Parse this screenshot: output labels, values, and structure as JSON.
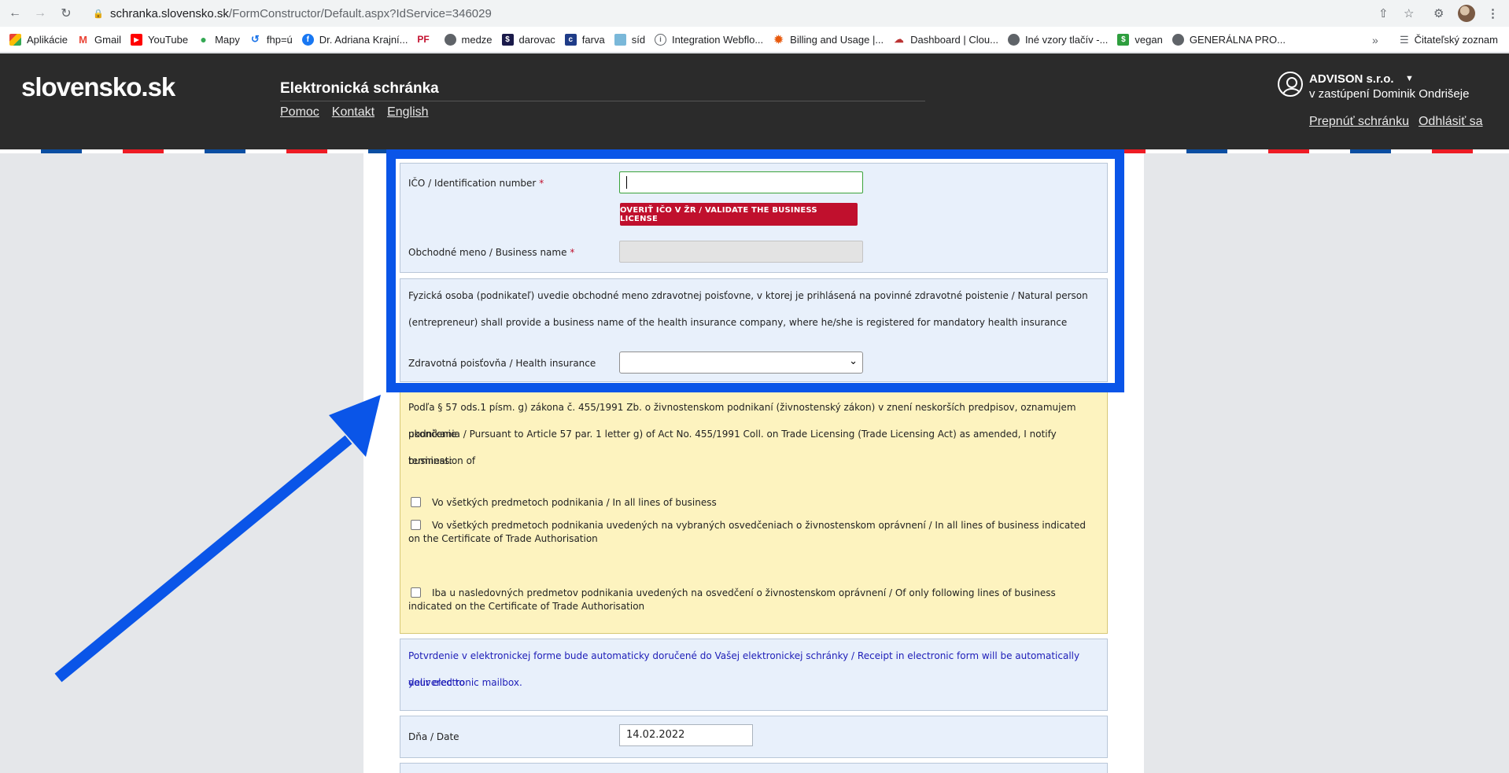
{
  "browser": {
    "url_host": "schranka.slovensko.sk",
    "url_path": "/FormConstructor/Default.aspx?IdService=346029",
    "bookmarks": [
      {
        "label": "Aplikácie",
        "icon": "apps-grid-icon"
      },
      {
        "label": "Gmail",
        "icon": "gmail-icon"
      },
      {
        "label": "YouTube",
        "icon": "youtube-icon"
      },
      {
        "label": "Mapy",
        "icon": "maps-pin-icon"
      },
      {
        "label": "fhp=ú",
        "icon": "history-icon"
      },
      {
        "label": "Dr. Adriana Krajní...",
        "icon": "facebook-icon"
      },
      {
        "label": "",
        "icon": "pf-icon"
      },
      {
        "label": "medze",
        "icon": "globe-icon"
      },
      {
        "label": "darovac",
        "icon": "dollar-icon"
      },
      {
        "label": "farva",
        "icon": "c-icon"
      },
      {
        "label": "síd",
        "icon": "sid-icon"
      },
      {
        "label": "Integration Webflo...",
        "icon": "info-icon"
      },
      {
        "label": "Billing and Usage |...",
        "icon": "sun-icon"
      },
      {
        "label": "Dashboard | Clou...",
        "icon": "cloud-icon"
      },
      {
        "label": "Iné vzory tlačív -...",
        "icon": "globe-icon"
      },
      {
        "label": "vegan",
        "icon": "vegan-icon"
      },
      {
        "label": "GENERÁLNA PRO...",
        "icon": "globe-icon"
      }
    ],
    "more_bookmarks": "»",
    "reading_list": "Čitateľský zoznam"
  },
  "header": {
    "logo": "slovensko.sk",
    "service_title": "Elektronická schránka",
    "links": [
      "Pomoc",
      "Kontakt",
      "English"
    ],
    "user_name": "ADVISON s.r.o.",
    "user_rep": "v zastúpení Dominik Ondrišeje",
    "switch_label": "Prepnúť schránku",
    "logout_label": "Odhlásiť sa"
  },
  "form": {
    "ico_label": "IČO / Identification number",
    "required_mark": "*",
    "validate_button": "OVERIŤ IČO V ŽR / VALIDATE THE BUSINESS LICENSE",
    "business_name_label": "Obchodné meno / Business name",
    "health_intro_line1": "Fyzická osoba (podnikateľ) uvedie obchodné meno zdravotnej poisťovne, v ktorej je prihlásená na povinné zdravotné poistenie / Natural person",
    "health_intro_line2": "(entrepreneur) shall provide a business name of the health insurance company, where he/she is registered for mandatory health insurance",
    "health_label": "Zdravotná poisťovňa / Health insurance",
    "termination_line1": "Podľa § 57 ods.1 písm. g) zákona č. 455/1991 Zb. o živnostenskom podnikaní (živnostenský zákon) v znení neskorších predpisov, oznamujem ukončenie",
    "termination_line2": "podnikania / Pursuant to Article 57 par. 1 letter g) of Act No. 455/1991 Coll. on Trade Licensing (Trade Licensing Act) as amended, I notify termination of",
    "termination_line3": "business:",
    "checkbox1": "Vo všetkých predmetoch podnikania / In all lines of business",
    "checkbox2": "Vo všetkých predmetoch podnikania uvedených na vybraných osvedčeniach o živnostenskom oprávnení / In all lines of business indicated on the Certificate of Trade Authorisation",
    "checkbox3": "Iba u nasledovných predmetov podnikania uvedených na osvedčení o živnostenskom oprávnení / Of only following lines of business indicated on the Certificate of Trade Authorisation",
    "receipt_line1": "Potvrdenie v elektronickej forme bude automaticky doručené do Vašej elektronickej schránky / Receipt in electronic form will be automatically delivered to",
    "receipt_line2": "your electronic mailbox.",
    "date_label": "Dňa / Date",
    "date_value": "14.02.2022"
  },
  "annotation": {
    "color": "#0a55e8"
  }
}
